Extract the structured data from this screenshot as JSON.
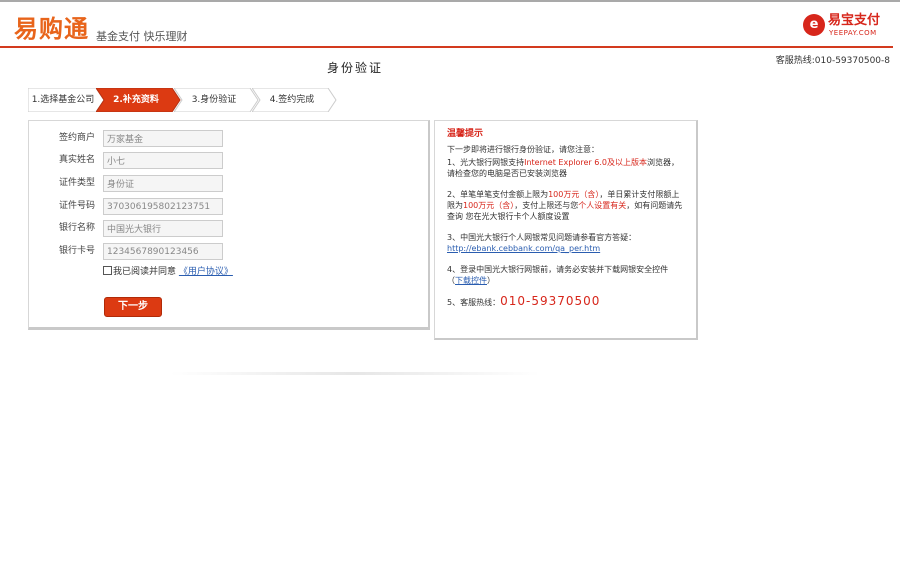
{
  "header": {
    "logo": "易购通",
    "slogan": "基金支付  快乐理财",
    "brand_icon": "e",
    "brand_cn": "易宝支付",
    "brand_en": "YEEPAY.COM",
    "hotline": "客服热线:010-59370500-8"
  },
  "page_title": "身份验证",
  "steps": [
    {
      "label": "1.选择基金公司",
      "active": false
    },
    {
      "label": "2.补充资料",
      "active": true
    },
    {
      "label": "3.身份验证",
      "active": false
    },
    {
      "label": "4.签约完成",
      "active": false
    }
  ],
  "form": {
    "fields": [
      {
        "label": "签约商户",
        "value": "万家基金"
      },
      {
        "label": "真实姓名",
        "value": "小七"
      },
      {
        "label": "证件类型",
        "value": "身份证"
      },
      {
        "label": "证件号码",
        "value": "370306195802123751"
      },
      {
        "label": "银行名称",
        "value": "中国光大银行"
      },
      {
        "label": "银行卡号",
        "value": "1234567890123456"
      }
    ],
    "agree_text": "我已阅读并同意",
    "agree_link": "《用户协议》",
    "next_button": "下一步"
  },
  "tips": {
    "title": "温馨提示",
    "intro": "下一步即将进行银行身份验证，请您注意：",
    "item1_a": "1、光大银行网银支持",
    "item1_red": "Internet Explorer 6.0及以上版本",
    "item1_b": "浏览器，请检查您的电脑是否已安装浏览器",
    "item2_a": "2、单笔单笔支付金额上限为",
    "item2_red1": "100万元（含）",
    "item2_b": "，单日累计支付限额上限为",
    "item2_red2": "100万元（含）",
    "item2_c": "，支付上限还与您",
    "item2_red3": "个人设置有关",
    "item2_d": "，如有问题请先查询 您在光大银行卡个人额度设置",
    "item3_a": "3、中国光大银行个人网银常见问题请参看官方答疑：",
    "item3_link": "http://ebank.cebbank.com/qa_per.htm",
    "item4_a": "4、登录中国光大银行网银前，请务必安装并下载网银安全控件（",
    "item4_link": "下载控件",
    "item4_b": "）",
    "item5_a": "5、客服热线：",
    "item5_num": "010-59370500"
  },
  "colors": {
    "accent": "#d7261b",
    "step_active": "#dc3a12"
  }
}
